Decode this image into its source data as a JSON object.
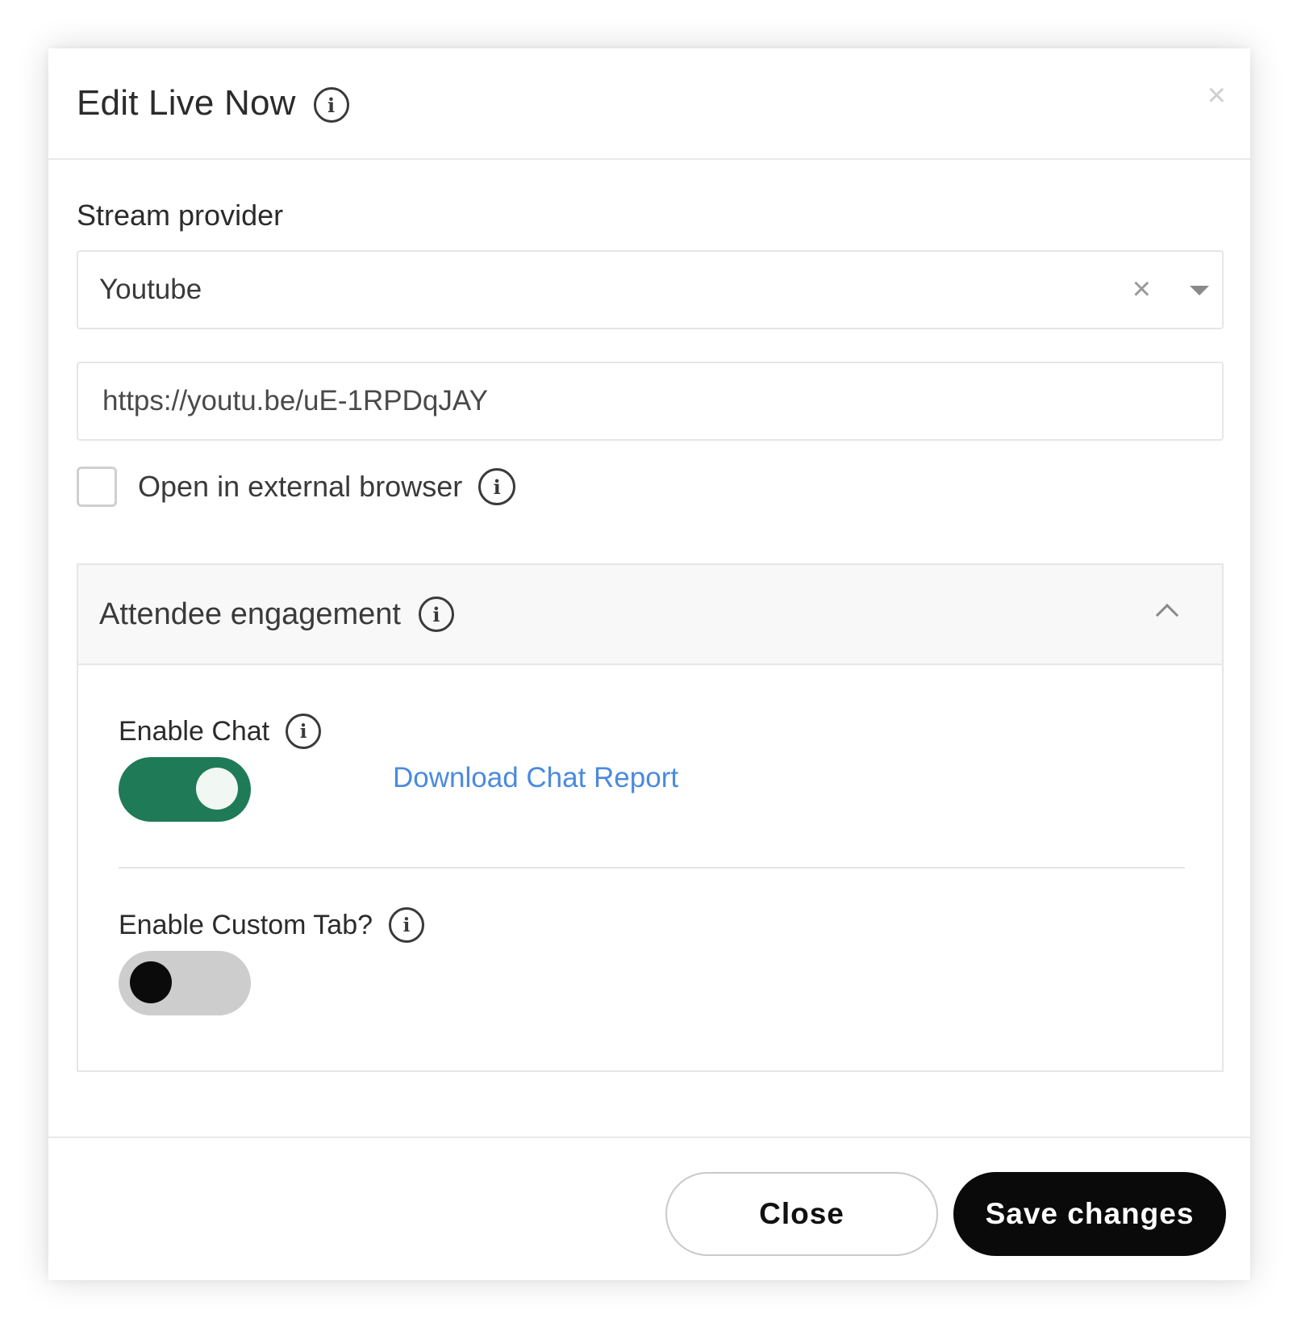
{
  "dialog": {
    "title": "Edit Live Now",
    "close_glyph": "×"
  },
  "stream_provider": {
    "label": "Stream provider",
    "selected": "Youtube",
    "clear_glyph": "×"
  },
  "url_field": {
    "value": "https://youtu.be/uE-1RPDqJAY"
  },
  "external_browser": {
    "label": "Open in external browser",
    "checked": false
  },
  "engagement": {
    "title": "Attendee engagement",
    "expanded": true,
    "enable_chat": {
      "label": "Enable Chat",
      "on": true
    },
    "download_link": "Download Chat Report",
    "enable_custom_tab": {
      "label": "Enable Custom Tab?",
      "on": false
    }
  },
  "footer": {
    "close_label": "Close",
    "save_label": "Save changes"
  },
  "icons": {
    "info": "info-icon",
    "close": "close-icon",
    "clear": "clear-icon",
    "caret": "caret-down-icon",
    "chevron": "chevron-up-icon"
  },
  "colors": {
    "toggle_on": "#1f7a57",
    "toggle_off": "#cdcdcd",
    "link": "#4a8adf",
    "primary_button": "#0a0a0a"
  }
}
